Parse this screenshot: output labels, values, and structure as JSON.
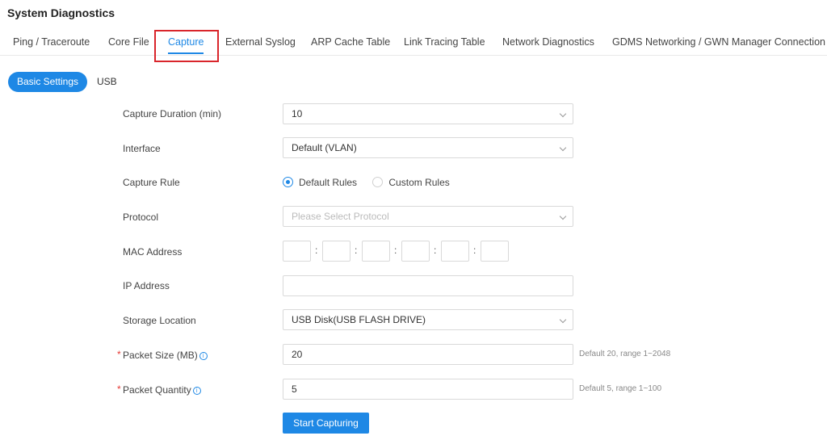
{
  "page": {
    "title": "System Diagnostics"
  },
  "tabs": [
    {
      "label": "Ping / Traceroute"
    },
    {
      "label": "Core File"
    },
    {
      "label": "Capture"
    },
    {
      "label": "External Syslog"
    },
    {
      "label": "ARP Cache Table"
    },
    {
      "label": "Link Tracing Table"
    },
    {
      "label": "Network Diagnostics"
    },
    {
      "label": "GDMS Networking / GWN Manager Connection Di"
    }
  ],
  "active_tab": "Capture",
  "subtabs": {
    "basic": "Basic Settings",
    "usb": "USB"
  },
  "form": {
    "capture_duration": {
      "label": "Capture Duration (min)",
      "value": "10"
    },
    "interface": {
      "label": "Interface",
      "value": "Default (VLAN)"
    },
    "capture_rule": {
      "label": "Capture Rule",
      "options": [
        "Default Rules",
        "Custom Rules"
      ],
      "selected": "Default Rules"
    },
    "protocol": {
      "label": "Protocol",
      "placeholder": "Please Select Protocol"
    },
    "mac_address": {
      "label": "MAC Address",
      "separator": ":"
    },
    "ip_address": {
      "label": "IP Address",
      "value": ""
    },
    "storage_location": {
      "label": "Storage Location",
      "value": "USB Disk(USB FLASH DRIVE)"
    },
    "packet_size": {
      "label": "Packet Size (MB)",
      "value": "20",
      "hint": "Default 20, range 1~2048"
    },
    "packet_quantity": {
      "label": "Packet Quantity",
      "value": "5",
      "hint": "Default 5, range 1~100"
    },
    "required_mark": "*",
    "info_glyph": "i"
  },
  "actions": {
    "start": "Start Capturing"
  },
  "colors": {
    "accent": "#1e88e5",
    "highlight": "#d9252b",
    "required": "#e53935"
  }
}
